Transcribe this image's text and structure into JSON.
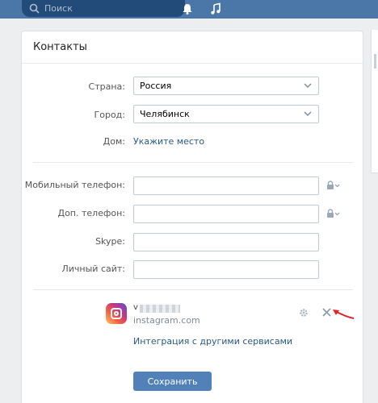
{
  "topbar": {
    "search_placeholder": "Поиск",
    "icons": [
      "search-icon",
      "bell-icon",
      "music-note-icon"
    ]
  },
  "card": {
    "title": "Контакты",
    "country": {
      "label": "Страна:",
      "value": "Россия"
    },
    "city": {
      "label": "Город:",
      "value": "Челябинск"
    },
    "home": {
      "label": "Дом:",
      "link": "Укажите место"
    },
    "mobile": {
      "label": "Мобильный телефон:",
      "value": ""
    },
    "extra_phone": {
      "label": "Доп. телефон:",
      "value": ""
    },
    "skype": {
      "label": "Skype:",
      "value": ""
    },
    "site": {
      "label": "Личный сайт:",
      "value": ""
    },
    "integration": {
      "account_name": "v",
      "service": "instagram.com",
      "link": "Интеграция с другими сервисами"
    },
    "save_label": "Сохранить"
  },
  "colors": {
    "topbar": "#4a76a8",
    "search_bg": "#224b7a",
    "link": "#2a5885",
    "button": "#5181b8",
    "arrow": "#e0232a"
  }
}
